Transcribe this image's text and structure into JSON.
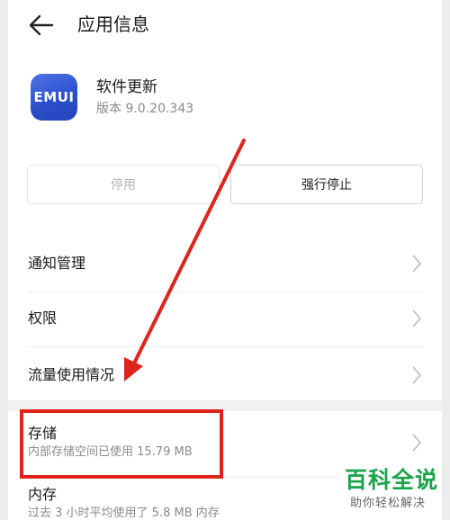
{
  "header": {
    "title": "应用信息"
  },
  "app": {
    "icon_text": "EMUI",
    "name": "软件更新",
    "version": "版本 9.0.20.343"
  },
  "actions": {
    "disable_label": "停用",
    "force_stop_label": "强行停止"
  },
  "settings": {
    "notifications": "通知管理",
    "permissions": "权限",
    "data_usage": "流量使用情况",
    "storage": "存储",
    "storage_detail": "内部存储空间已使用 15.79 MB",
    "memory": "内存",
    "memory_detail": "过去 3 小时平均使用了 5.8 MB 内存"
  },
  "watermark": {
    "title": "百科全说",
    "subtitle": "助你轻松解决"
  },
  "colors": {
    "annotation_red": "#e0231b",
    "icon_blue": "#2c4fcd",
    "watermark_green": "#1aa34a"
  }
}
